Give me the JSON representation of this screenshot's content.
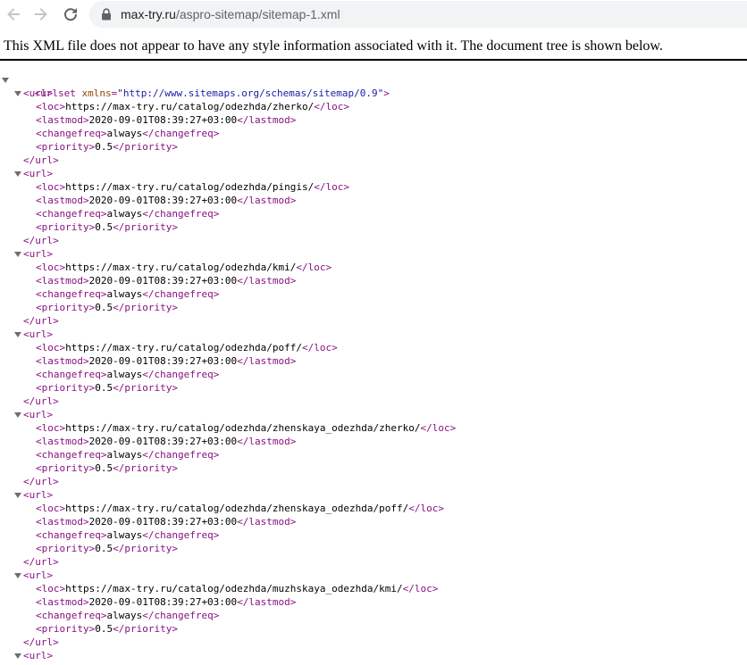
{
  "browser": {
    "url_host": "max-try.ru",
    "url_path": "/aspro-sitemap/sitemap-1.xml"
  },
  "xml_notice": "This XML file does not appear to have any style information associated with it. The document tree is shown below.",
  "urlset": {
    "open_tag": "<urlset",
    "attr_name": "xmlns",
    "attr_eq": "=",
    "attr_value": "\"http://www.sitemaps.org/schemas/sitemap/0.9\"",
    "open_end": ">"
  },
  "urls": [
    {
      "loc": "https://max-try.ru/catalog/odezhda/zherko/",
      "lastmod": "2020-09-01T08:39:27+03:00",
      "changefreq": "always",
      "priority": "0.5"
    },
    {
      "loc": "https://max-try.ru/catalog/odezhda/pingis/",
      "lastmod": "2020-09-01T08:39:27+03:00",
      "changefreq": "always",
      "priority": "0.5"
    },
    {
      "loc": "https://max-try.ru/catalog/odezhda/kmi/",
      "lastmod": "2020-09-01T08:39:27+03:00",
      "changefreq": "always",
      "priority": "0.5"
    },
    {
      "loc": "https://max-try.ru/catalog/odezhda/poff/",
      "lastmod": "2020-09-01T08:39:27+03:00",
      "changefreq": "always",
      "priority": "0.5"
    },
    {
      "loc": "https://max-try.ru/catalog/odezhda/zhenskaya_odezhda/zherko/",
      "lastmod": "2020-09-01T08:39:27+03:00",
      "changefreq": "always",
      "priority": "0.5"
    },
    {
      "loc": "https://max-try.ru/catalog/odezhda/zhenskaya_odezhda/poff/",
      "lastmod": "2020-09-01T08:39:27+03:00",
      "changefreq": "always",
      "priority": "0.5"
    },
    {
      "loc": "https://max-try.ru/catalog/odezhda/muzhskaya_odezhda/kmi/",
      "lastmod": "2020-09-01T08:39:27+03:00",
      "changefreq": "always",
      "priority": "0.5"
    }
  ],
  "tags": {
    "url_open": "<url>",
    "url_close": "</url>",
    "loc_open": "<loc>",
    "loc_close": "</loc>",
    "lastmod_open": "<lastmod>",
    "lastmod_close": "</lastmod>",
    "changefreq_open": "<changefreq>",
    "changefreq_close": "</changefreq>",
    "priority_open": "<priority>",
    "priority_close": "</priority>"
  },
  "icons": {
    "back": "arrow-left",
    "forward": "arrow-right",
    "reload": "reload",
    "lock": "lock",
    "expand": "triangle-down"
  },
  "colors": {
    "tag": "#881280",
    "attr_name": "#994500",
    "attr_value": "#1a1aa6",
    "text": "#000000",
    "toggle": "#6e6e6e"
  }
}
